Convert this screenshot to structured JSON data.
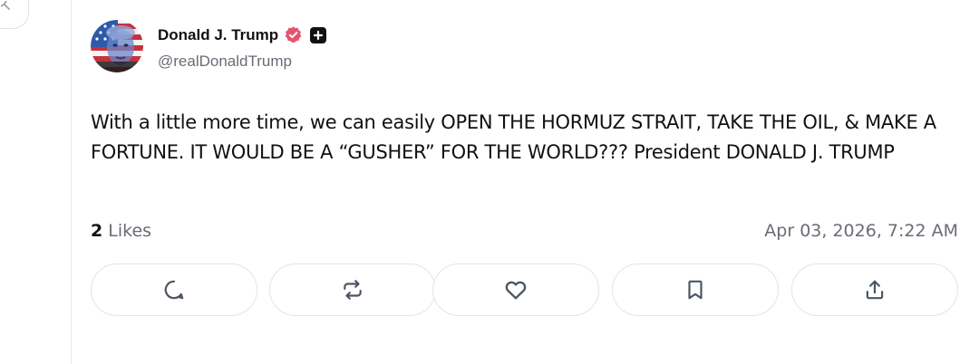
{
  "post": {
    "author": {
      "display_name": "Donald J. Trump",
      "handle": "@realDonaldTrump",
      "verified_icon": "verified-badge-icon",
      "plus_icon": "plus-badge-icon",
      "verified_color": "#e0566f"
    },
    "text": "With a little more time, we can easily OPEN THE HORMUZ STRAIT, TAKE THE OIL, & MAKE A FORTUNE. IT WOULD BE A “GUSHER” FOR THE WORLD??? President DONALD J. TRUMP",
    "likes": {
      "count": "2",
      "label": "Likes"
    },
    "timestamp": "Apr 03, 2026, 7:22 AM",
    "actions": [
      {
        "name": "reply",
        "icon": "comment-icon"
      },
      {
        "name": "repost",
        "icon": "repost-icon"
      },
      {
        "name": "like",
        "icon": "heart-icon"
      },
      {
        "name": "bookmark",
        "icon": "bookmark-icon"
      },
      {
        "name": "share",
        "icon": "share-icon"
      }
    ]
  },
  "sidebar": {
    "search_icon": "search-icon"
  },
  "colors": {
    "text": "#111111",
    "muted": "#6b6b76",
    "border": "#e4e4ea",
    "icon": "#4b5563"
  }
}
